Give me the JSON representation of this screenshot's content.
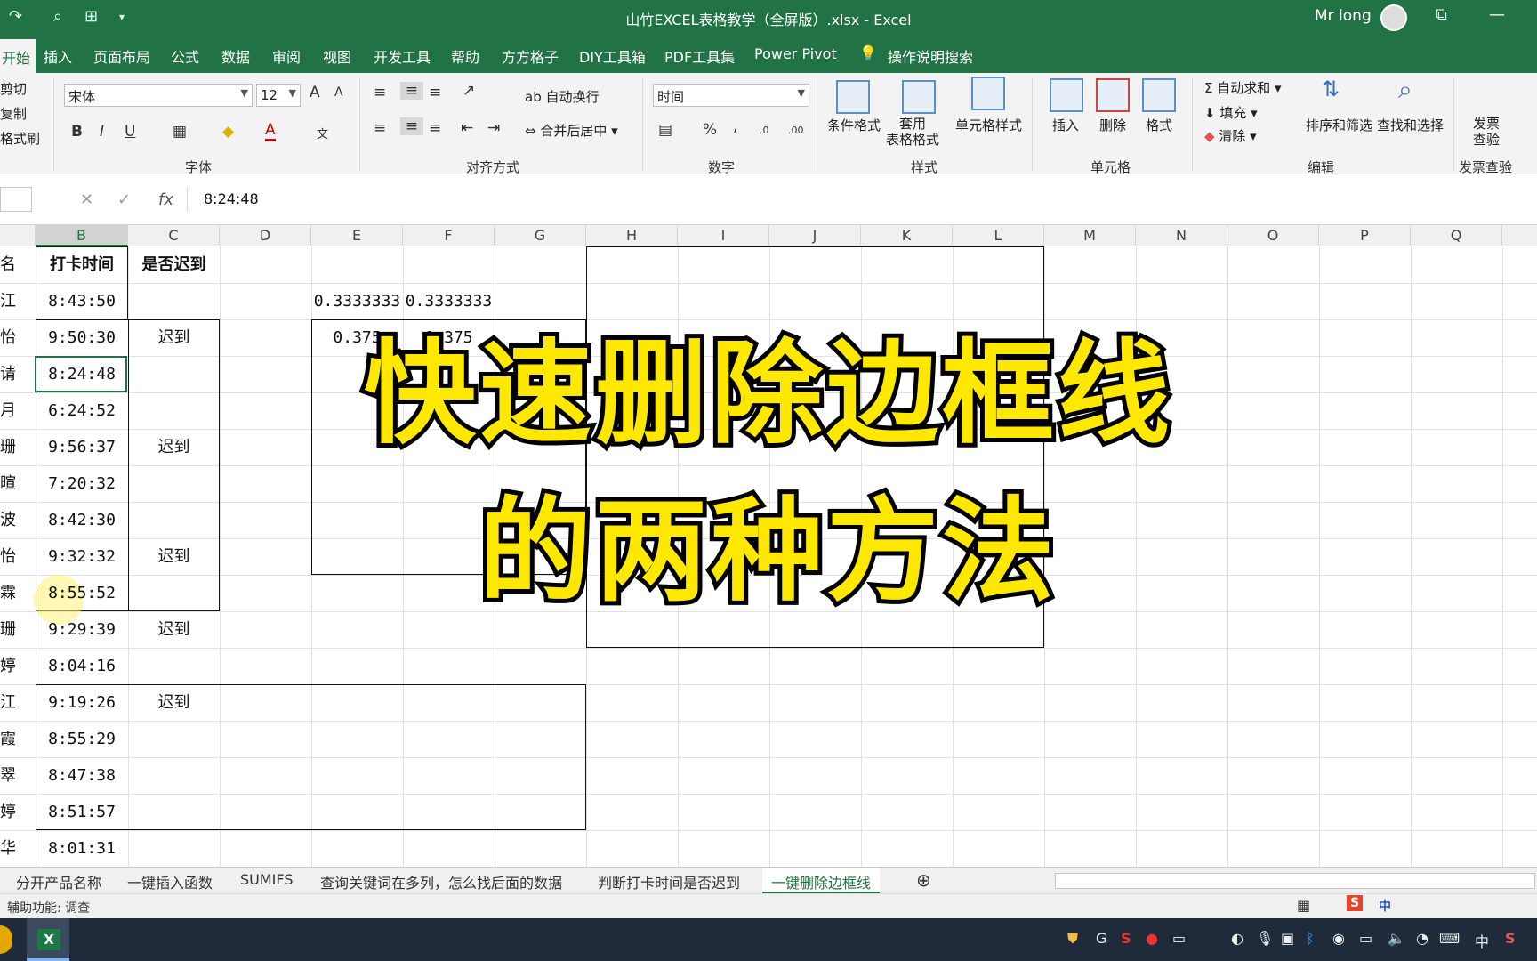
{
  "titlebar": {
    "title": "山竹EXCEL表格教学（全屏版）.xlsx  -  Excel",
    "user": "Mr long",
    "restore": "⧉",
    "minimize": "—",
    "qa_undo": "↷",
    "qa_preview": "⌕",
    "qa_grid": "⊞",
    "qa_more": "▾"
  },
  "tabs": [
    "开始",
    "插入",
    "页面布局",
    "公式",
    "数据",
    "审阅",
    "视图",
    "开发工具",
    "帮助",
    "方方格子",
    "DIY工具箱",
    "PDF工具集",
    "Power Pivot",
    "操作说明搜索"
  ],
  "ribbon": {
    "clipboard": {
      "cut": "剪切",
      "copy": "复制",
      "painter": "格式刷"
    },
    "font": {
      "name": "宋体",
      "size": "12",
      "group": "字体",
      "bold": "B",
      "italic": "I",
      "underline": "U",
      "grow": "A",
      "shrink": "A",
      "color": "A",
      "phonetic": "文"
    },
    "alignment": {
      "wrap": "自动换行",
      "merge": "合并后居中",
      "group": "对齐方式"
    },
    "number": {
      "format": "时间",
      "group": "数字",
      "percent": "%",
      "comma": ","
    },
    "styles": {
      "conditional": "条件格式",
      "table": "套用\n表格格式",
      "cell": "单元格样式",
      "group": "样式"
    },
    "cells": {
      "insert": "插入",
      "delete": "删除",
      "format": "格式",
      "group": "单元格"
    },
    "editing": {
      "autosum": "自动求和",
      "fill": "填充",
      "clear": "清除",
      "sort": "排序和筛选",
      "find": "查找和选择",
      "group": "编辑"
    },
    "invoice": {
      "check": "发票\n查验",
      "group": "发票查验"
    }
  },
  "formula": {
    "value": "8:24:48",
    "fx": "fx",
    "cancel": "✕",
    "confirm": "✓"
  },
  "columns": [
    "B",
    "C",
    "D",
    "E",
    "F",
    "G",
    "H",
    "I",
    "J",
    "K",
    "L",
    "M",
    "N",
    "O",
    "P",
    "Q"
  ],
  "rows": [
    {
      "a": "名",
      "b": "打卡时间",
      "c": "是否迟到"
    },
    {
      "a": "江",
      "b": "8:43:50",
      "c": ""
    },
    {
      "a": "怡",
      "b": "9:50:30",
      "c": "迟到"
    },
    {
      "a": "请",
      "b": "8:24:48",
      "c": ""
    },
    {
      "a": "月",
      "b": "6:24:52",
      "c": ""
    },
    {
      "a": "珊",
      "b": "9:56:37",
      "c": "迟到"
    },
    {
      "a": "暄",
      "b": "7:20:32",
      "c": ""
    },
    {
      "a": "波",
      "b": "8:42:30",
      "c": ""
    },
    {
      "a": "怡",
      "b": "9:32:32",
      "c": "迟到"
    },
    {
      "a": "霖",
      "b": "8:55:52",
      "c": ""
    },
    {
      "a": "珊",
      "b": "9:29:39",
      "c": "迟到"
    },
    {
      "a": "婷",
      "b": "8:04:16",
      "c": ""
    },
    {
      "a": "江",
      "b": "9:19:26",
      "c": "迟到"
    },
    {
      "a": "霞",
      "b": "8:55:29",
      "c": ""
    },
    {
      "a": "翠",
      "b": "8:47:38",
      "c": ""
    },
    {
      "a": "婷",
      "b": "8:51:57",
      "c": ""
    },
    {
      "a": "华",
      "b": "8:01:31",
      "c": ""
    }
  ],
  "extra": {
    "e2": "0.3333333",
    "f2": "0.3333333",
    "e3": "0.375",
    "f3": "0.375"
  },
  "overlay": {
    "line1": "快速删除边框线",
    "line2": "的两种方法"
  },
  "sheets": [
    "分开产品名称",
    "一键插入函数",
    "SUMIFS",
    "查询关键词在多列，怎么找后面的数据",
    "判断打卡时间是否迟到",
    "一键删除边框线"
  ],
  "status": {
    "accessibility": "辅助功能: 调查"
  },
  "taskbar": {
    "ime": "中"
  }
}
